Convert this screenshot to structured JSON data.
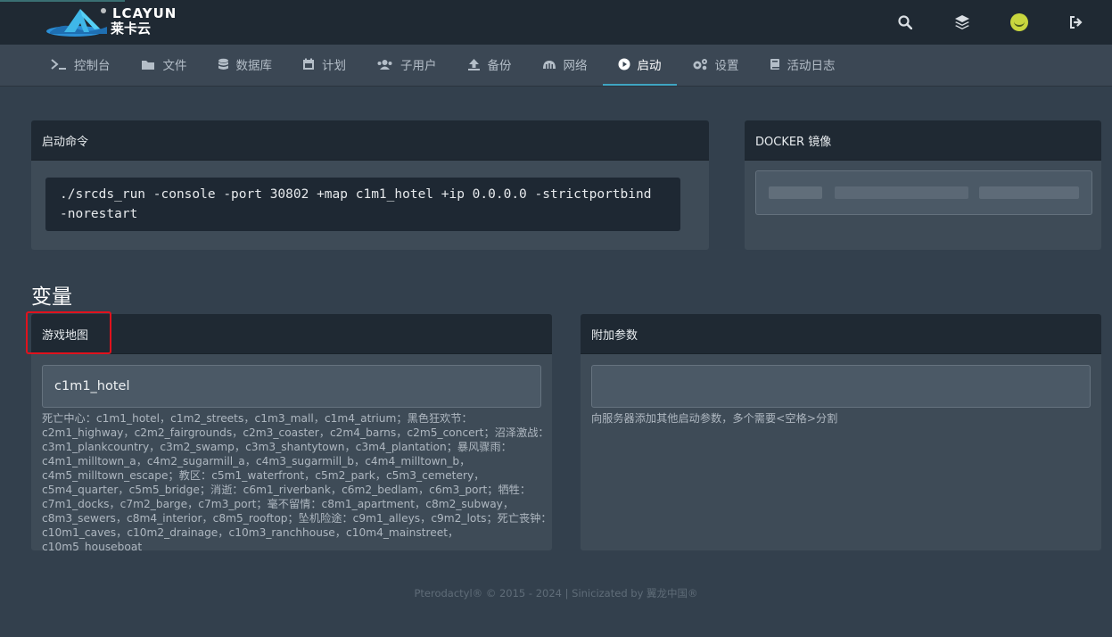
{
  "brand": {
    "logo_text_top": "LCAYUN",
    "logo_text_bottom": "莱卡云"
  },
  "header_icons": [
    "search-icon",
    "layers-icon",
    "avatar",
    "logout-icon"
  ],
  "nav": {
    "items": [
      {
        "label": "控制台",
        "icon": "terminal-icon"
      },
      {
        "label": "文件",
        "icon": "folder-icon"
      },
      {
        "label": "数据库",
        "icon": "database-icon"
      },
      {
        "label": "计划",
        "icon": "calendar-icon"
      },
      {
        "label": "子用户",
        "icon": "users-icon"
      },
      {
        "label": "备份",
        "icon": "upload-icon"
      },
      {
        "label": "网络",
        "icon": "network-icon"
      },
      {
        "label": "启动",
        "icon": "play-icon"
      },
      {
        "label": "设置",
        "icon": "gears-icon"
      },
      {
        "label": "活动日志",
        "icon": "book-icon"
      }
    ],
    "active": "启动"
  },
  "startup": {
    "title": "启动命令",
    "command": "./srcds_run -console -port 30802 +map c1m1_hotel +ip 0.0.0.0 -strictportbind -norestart"
  },
  "docker": {
    "title": "DOCKER 镜像"
  },
  "variables": {
    "section_title": "变量",
    "map": {
      "title": "游戏地图",
      "value": "c1m1_hotel",
      "help_lines": [
        "死亡中心：c1m1_hotel，c1m2_streets，c1m3_mall，c1m4_atrium；黑色狂欢节：",
        "c2m1_highway，c2m2_fairgrounds，c2m3_coaster，c2m4_barns，c2m5_concert；沼泽激战：",
        "c3m1_plankcountry，c3m2_swamp，c3m3_shantytown，c3m4_plantation；暴风骤雨：",
        "c4m1_milltown_a，c4m2_sugarmill_a，c4m3_sugarmill_b，c4m4_milltown_b，",
        "c4m5_milltown_escape；教区：c5m1_waterfront，c5m2_park，c5m3_cemetery，",
        "c5m4_quarter，c5m5_bridge；消逝：c6m1_riverbank，c6m2_bedlam，c6m3_port；牺牲：",
        "c7m1_docks，c7m2_barge，c7m3_port；毫不留情：c8m1_apartment，c8m2_subway，",
        "c8m3_sewers，c8m4_interior，c8m5_rooftop；坠机险途：c9m1_alleys，c9m2_lots；死亡丧钟：",
        "c10m1_caves，c10m2_drainage，c10m3_ranchhouse，c10m4_mainstreet，c10m5_houseboat"
      ]
    },
    "extra": {
      "title": "附加参数",
      "value": "",
      "help": "向服务器添加其他启动参数，多个需要<空格>分割"
    }
  },
  "footer": "Pterodactyl® © 2015 - 2024 | Sinicizated by 翼龙中国®",
  "colors": {
    "background": "#33404d",
    "header": "#1f2933",
    "active_underline": "#3fa5c2",
    "highlight": "#e0121d"
  }
}
